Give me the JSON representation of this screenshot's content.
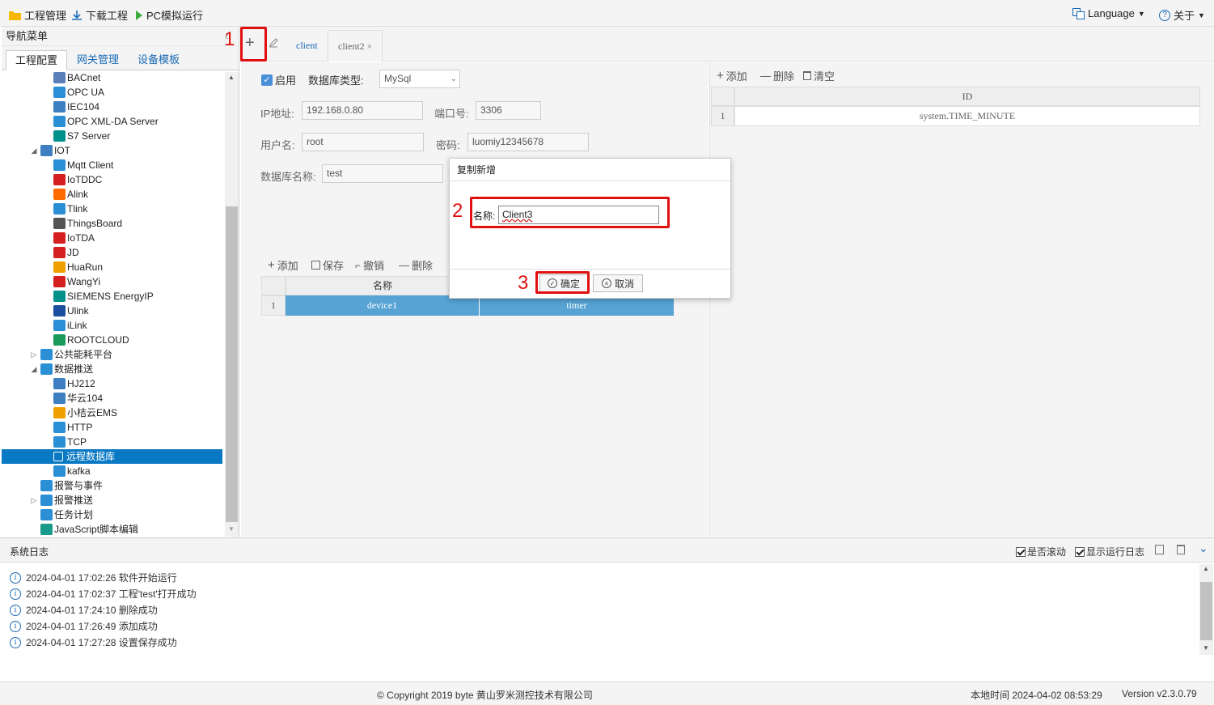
{
  "topbar": {
    "project_manage": "工程管理",
    "download_project": "下载工程",
    "pc_sim_run": "PC模拟运行",
    "language": "Language",
    "about": "关于"
  },
  "nav": {
    "title": "导航菜单",
    "tabs": [
      "工程配置",
      "网关管理",
      "设备模板"
    ],
    "items": [
      {
        "label": "BACnet",
        "icon": "bacnet-icon",
        "color": "#5b7fb8"
      },
      {
        "label": "OPC UA",
        "icon": "opcua-icon",
        "color": "#2b8fd6"
      },
      {
        "label": "IEC104",
        "icon": "iec-icon",
        "color": "#3d7fc0"
      },
      {
        "label": "OPC XML-DA Server",
        "icon": "opc-xml-icon",
        "color": "#2b8fd6"
      },
      {
        "label": "S7 Server",
        "icon": "s7-icon",
        "color": "#00918a"
      },
      {
        "label": "IOT",
        "icon": "iot-icon",
        "color": "#3d7fc0"
      },
      {
        "label": "Mqtt Client",
        "icon": "mqtt-icon",
        "color": "#2b8fd6"
      },
      {
        "label": "IoTDDC",
        "icon": "iotddc-icon",
        "color": "#d42020"
      },
      {
        "label": "Alink",
        "icon": "alink-icon",
        "color": "#ff6a00"
      },
      {
        "label": "Tlink",
        "icon": "tlink-icon",
        "color": "#2b8fd6"
      },
      {
        "label": "ThingsBoard",
        "icon": "thingsboard-icon",
        "color": "#555555"
      },
      {
        "label": "IoTDA",
        "icon": "huawei-icon",
        "color": "#d42020"
      },
      {
        "label": "JD",
        "icon": "jd-icon",
        "color": "#d42020"
      },
      {
        "label": "HuaRun",
        "icon": "huarun-icon",
        "color": "#f0a000"
      },
      {
        "label": "WangYi",
        "icon": "wangyi-icon",
        "color": "#d42020"
      },
      {
        "label": "SIEMENS EnergyIP",
        "icon": "siemens-icon",
        "color": "#00918a"
      },
      {
        "label": "Ulink",
        "icon": "ulink-icon",
        "color": "#1a4fa0"
      },
      {
        "label": "iLink",
        "icon": "ilink-icon",
        "color": "#2b8fd6"
      },
      {
        "label": "ROOTCLOUD",
        "icon": "rootcloud-icon",
        "color": "#1a9a5a"
      },
      {
        "label": "公共能耗平台",
        "icon": "energy-platform-icon",
        "color": "#2b8fd6"
      },
      {
        "label": "数据推送",
        "icon": "data-push-icon",
        "color": "#2b8fd6"
      },
      {
        "label": "HJ212",
        "icon": "hj212-icon",
        "color": "#3d7fc0"
      },
      {
        "label": "华云104",
        "icon": "iec-icon",
        "color": "#3d7fc0"
      },
      {
        "label": "小桔云EMS",
        "icon": "ems-icon",
        "color": "#f0a000"
      },
      {
        "label": "HTTP",
        "icon": "http-icon",
        "color": "#2b8fd6"
      },
      {
        "label": "TCP",
        "icon": "tcp-icon",
        "color": "#2b8fd6"
      },
      {
        "label": "远程数据库",
        "icon": "database-icon",
        "color": "#ffffff"
      },
      {
        "label": "kafka",
        "icon": "kafka-icon",
        "color": "#2b8fd6"
      },
      {
        "label": "报警与事件",
        "icon": "alarm-icon",
        "color": "#2b8fd6"
      },
      {
        "label": "报警推送",
        "icon": "alarm-push-icon",
        "color": "#2b8fd6"
      },
      {
        "label": "任务计划",
        "icon": "task-icon",
        "color": "#2b8fd6"
      },
      {
        "label": "JavaScript脚本编辑",
        "icon": "js-icon",
        "color": "#1a9a8a"
      }
    ]
  },
  "editor_tabs": {
    "tabs": [
      "client",
      "client2"
    ]
  },
  "form": {
    "enable_label": "启用",
    "db_type_label": "数据库类型:",
    "db_type_value": "MySql",
    "ip_label": "IP地址:",
    "ip_value": "192.168.0.80",
    "port_label": "端口号:",
    "port_value": "3306",
    "user_label": "用户名:",
    "user_value": "root",
    "password_label": "密码:",
    "password_value": "luomiy12345678",
    "dbname_label": "数据库名称:",
    "dbname_value": "test"
  },
  "device_table": {
    "toolbar": [
      "添加",
      "保存",
      "撤销",
      "删除"
    ],
    "columns": [
      "名称",
      ""
    ],
    "rows": [
      {
        "index": "1",
        "name": "device1",
        "type": "timer"
      }
    ]
  },
  "right_panel": {
    "toolbar": [
      "添加",
      "删除",
      "清空"
    ],
    "column": "ID",
    "rows": [
      {
        "index": "1",
        "id": "system.TIME_MINUTE"
      }
    ]
  },
  "dialog": {
    "title": "复制新增",
    "name_label": "名称:",
    "name_value": "Client3",
    "ok": "确定",
    "cancel": "取消"
  },
  "annotations": [
    "1",
    "2",
    "3"
  ],
  "log": {
    "title": "系统日志",
    "auto_scroll": "是否滚动",
    "show_log": "显示运行日志",
    "entries": [
      "2024-04-01 17:02:26 软件开始运行",
      "2024-04-01 17:02:37 工程'test'打开成功",
      "2024-04-01 17:24:10 删除成功",
      "2024-04-01 17:26:49 添加成功",
      "2024-04-01 17:27:28 设置保存成功"
    ]
  },
  "footer": {
    "copyright": "© Copyright 2019 byte 黄山罗米测控技术有限公司",
    "local_time": "本地时间 2024-04-02 08:53:29",
    "version": "Version v2.3.0.79"
  }
}
